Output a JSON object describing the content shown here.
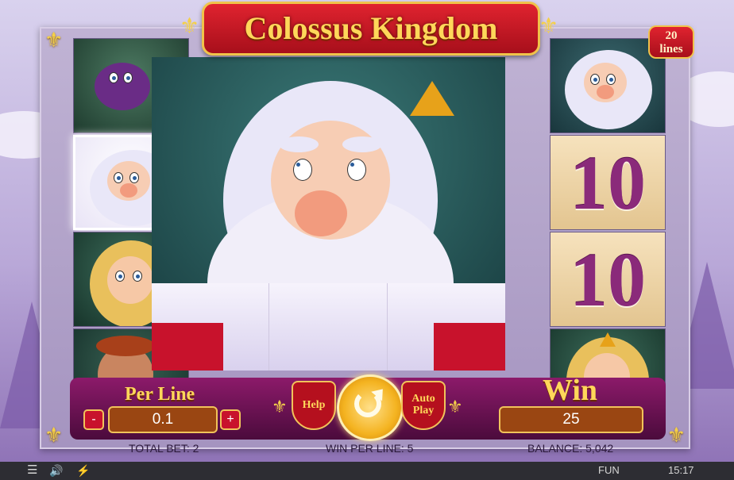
{
  "game": {
    "title": "Colossus Kingdom",
    "lines_badge": {
      "number": "20",
      "word": "lines"
    }
  },
  "reels": {
    "left": [
      "dragon",
      "king",
      "princess",
      "hero"
    ],
    "right": [
      "king",
      "ten",
      "ten",
      "princess"
    ],
    "ten_label": "10",
    "big_symbol": "king"
  },
  "controls": {
    "per_line_label": "Per Line",
    "per_line_value": "0.1",
    "minus_label": "-",
    "plus_label": "+",
    "help_label": "Help",
    "auto_label_1": "Auto",
    "auto_label_2": "Play",
    "win_label": "Win",
    "win_value": "25"
  },
  "info": {
    "total_bet": "TOTAL BET: 2",
    "win_per_line": "WIN PER LINE: 5",
    "balance": "BALANCE: 5,042"
  },
  "bar": {
    "mode": "FUN",
    "clock": "15:17",
    "menu_icon": "menu-icon",
    "sound_icon": "speaker-icon",
    "turbo_icon": "lightning-icon"
  },
  "colors": {
    "title_red": "#e0232f",
    "gold": "#ffd75a",
    "panel_purple": "#8c1a6a",
    "ten_purple": "#8a2a7a"
  }
}
